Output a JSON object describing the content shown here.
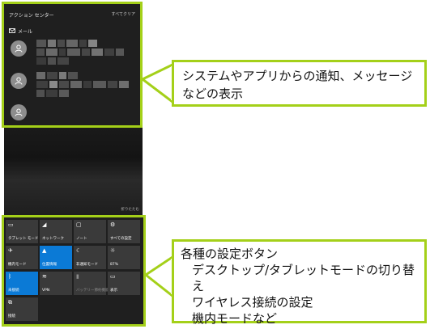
{
  "action_center": {
    "title": "アクション センター",
    "clear_all": "すべてクリア",
    "mail_app_label": "メール",
    "hide_notifications": "折りたたむ"
  },
  "quick_actions": [
    {
      "label": "タブレット モード",
      "icon": "tablet-icon",
      "active": false
    },
    {
      "label": "ネットワーク",
      "icon": "network-icon",
      "active": false
    },
    {
      "label": "ノート",
      "icon": "note-icon",
      "active": false
    },
    {
      "label": "すべての設定",
      "icon": "gear-icon",
      "active": false
    },
    {
      "label": "機内モード",
      "icon": "airplane-icon",
      "active": false
    },
    {
      "label": "位置情報",
      "icon": "location-icon",
      "active": true
    },
    {
      "label": "非通知モード",
      "icon": "moon-icon",
      "active": false
    },
    {
      "label": "87%",
      "icon": "brightness-icon",
      "active": false
    },
    {
      "label": "未接続",
      "icon": "bluetooth-icon",
      "active": true
    },
    {
      "label": "VPN",
      "icon": "vpn-icon",
      "active": false
    },
    {
      "label": "バッテリー節約機能",
      "icon": "battery-icon",
      "active": false,
      "dim": true
    },
    {
      "label": "表示",
      "icon": "display-icon",
      "active": false
    },
    {
      "label": "接続",
      "icon": "connect-icon",
      "active": false
    }
  ],
  "callouts": {
    "notifications": "システムやアプリからの通知、メッセージなどの表示",
    "settings_title": "各種の設定ボタン",
    "settings_items": [
      "デスクトップ/タブレットモードの切り替え",
      "ワイヤレス接続の設定",
      "機内モードなど"
    ]
  },
  "colors": {
    "highlight": "#a4d019",
    "tile_active": "#0b7ad6",
    "tile_inactive": "#3a3a3a",
    "panel_bg": "#1f1f1f"
  }
}
